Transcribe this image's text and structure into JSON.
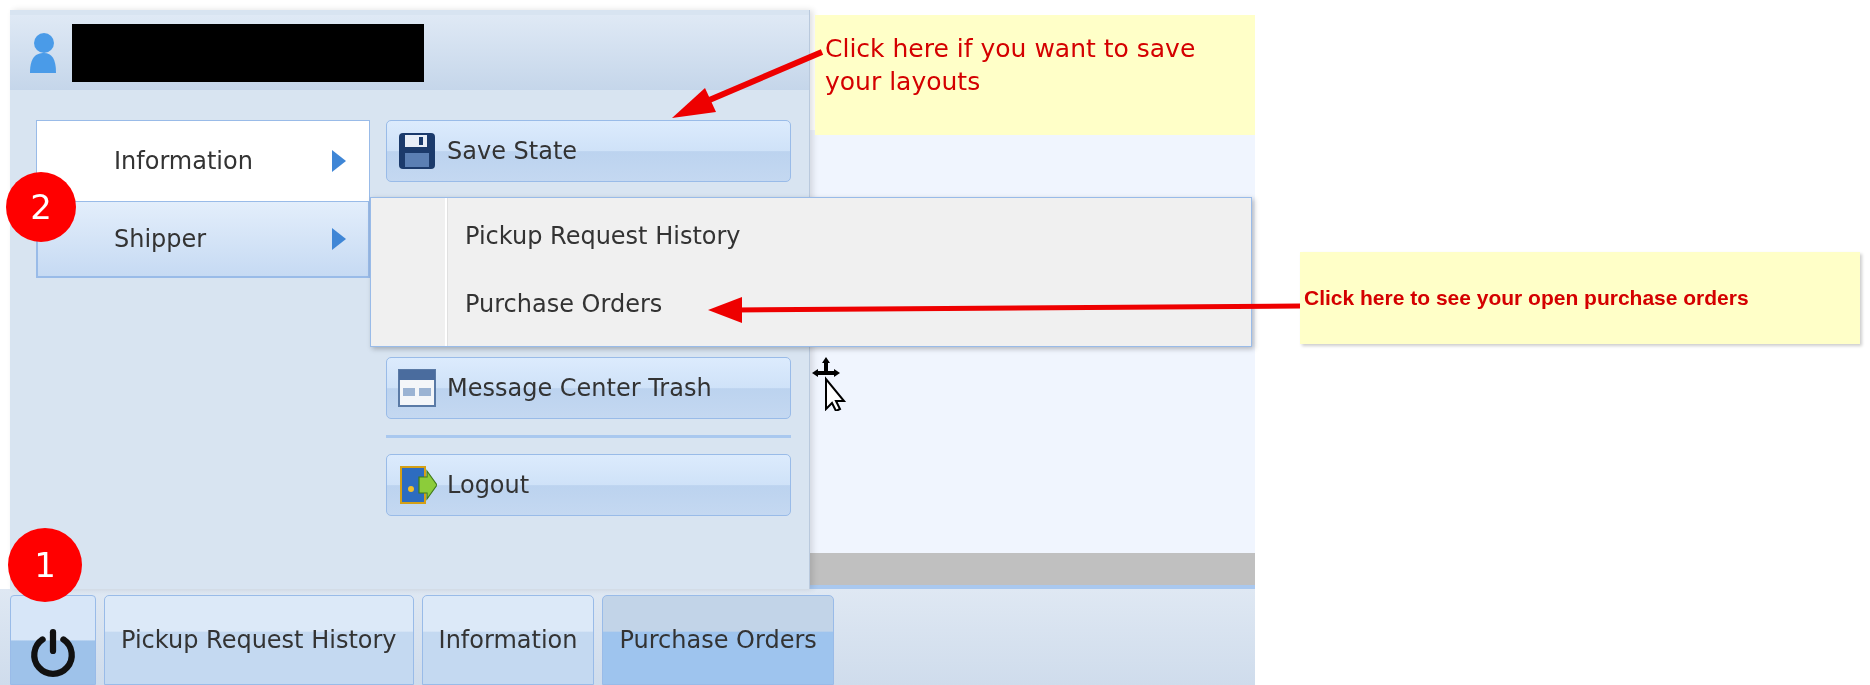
{
  "start_menu": {
    "categories": [
      {
        "label": "Information",
        "selected": false
      },
      {
        "label": "Shipper",
        "selected": true
      }
    ],
    "tools": [
      {
        "label": "Save State",
        "kind": "save"
      },
      {
        "label": "Message Center Trash",
        "kind": "trash"
      },
      {
        "label": "Logout",
        "kind": "logout"
      }
    ]
  },
  "submenu": {
    "items": [
      "Pickup Request History",
      "Purchase Orders"
    ]
  },
  "taskbar": {
    "buttons": [
      {
        "label": "Pickup Request History",
        "selected": false
      },
      {
        "label": "Information",
        "selected": false
      },
      {
        "label": "Purchase Orders",
        "selected": true
      }
    ]
  },
  "callouts": [
    "Click here if you want to save your layouts",
    "Click here to see your open purchase orders"
  ],
  "step_badges": [
    "2",
    "1"
  ]
}
